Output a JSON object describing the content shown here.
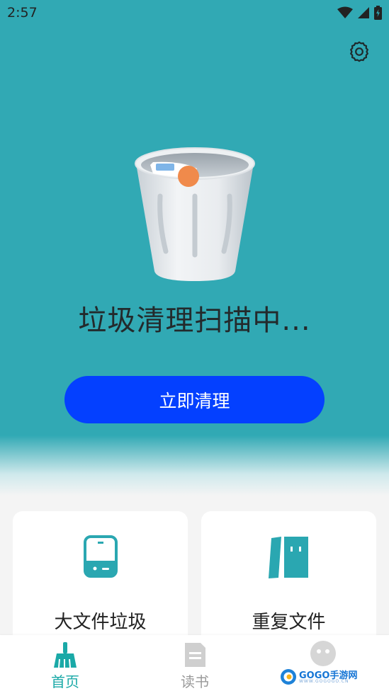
{
  "status_bar": {
    "time": "2:57"
  },
  "hero": {
    "scan_status": "垃圾清理扫描中...",
    "clean_button": "立即清理"
  },
  "cards": [
    {
      "label": "大文件垃圾",
      "icon": "hard-drive-icon"
    },
    {
      "label": "重复文件",
      "icon": "duplicate-files-icon"
    }
  ],
  "bottom_nav": {
    "items": [
      {
        "label": "首页",
        "icon": "broom-icon",
        "active": true
      },
      {
        "label": "读书",
        "icon": "document-icon",
        "active": false
      }
    ]
  },
  "watermark": {
    "text": "GOGO手游网",
    "sub": "WWW.GOGOGO.CN"
  },
  "colors": {
    "accent": "#31a9b4",
    "button": "#0440ff",
    "nav_active": "#1aa9a7"
  }
}
